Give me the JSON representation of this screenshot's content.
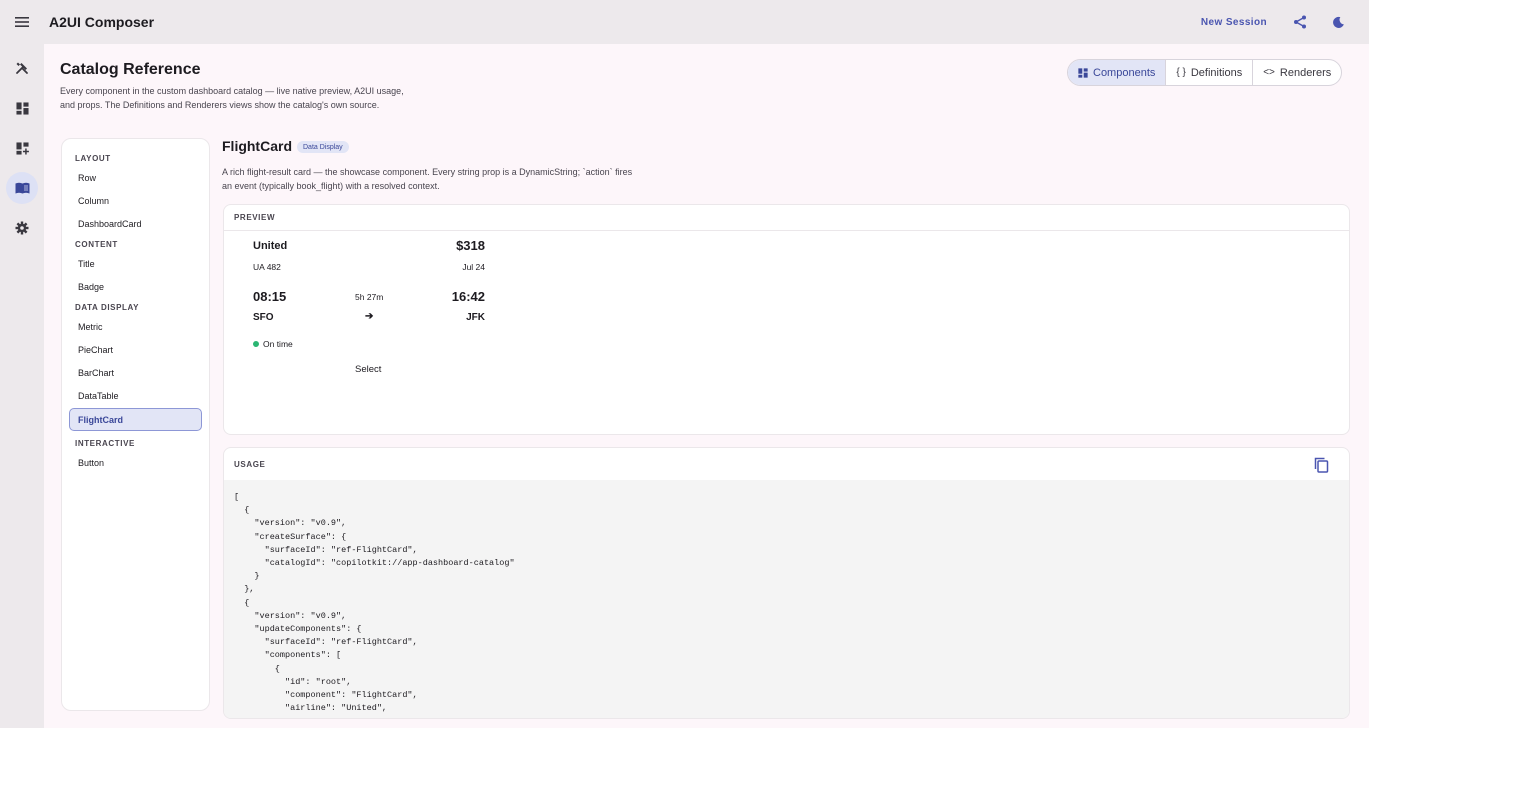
{
  "topbar": {
    "app_title": "A2UI Composer",
    "new_session_label": "New Session"
  },
  "colors": {
    "accent": "#4a55b0",
    "status_on_time": "#2bb673",
    "top_bar_bg": "#ede9ec",
    "page_bg": "#fdf6fa"
  },
  "rail": {
    "items": [
      {
        "icon": "tools-icon"
      },
      {
        "icon": "dashboard-icon"
      },
      {
        "icon": "dashboard-add-icon"
      },
      {
        "icon": "book-icon",
        "active": true
      },
      {
        "icon": "gear-icon"
      }
    ]
  },
  "header": {
    "title": "Catalog Reference",
    "description": "Every component in the custom dashboard catalog — live native preview, A2UI usage, and props. The Definitions and Renderers views show the catalog's own source."
  },
  "view_tabs": [
    {
      "label": "Components",
      "icon": "grid-icon",
      "active": true
    },
    {
      "label": "Definitions",
      "icon": "braces-icon",
      "active": false
    },
    {
      "label": "Renderers",
      "icon": "code-icon",
      "active": false
    }
  ],
  "catalog": {
    "groups": [
      {
        "label": "LAYOUT",
        "items": [
          "Row",
          "Column",
          "DashboardCard"
        ]
      },
      {
        "label": "CONTENT",
        "items": [
          "Title",
          "Badge"
        ]
      },
      {
        "label": "DATA DISPLAY",
        "items": [
          "Metric",
          "PieChart",
          "BarChart",
          "DataTable",
          "FlightCard"
        ]
      },
      {
        "label": "INTERACTIVE",
        "items": [
          "Button"
        ]
      }
    ],
    "selected": "FlightCard"
  },
  "detail": {
    "title": "FlightCard",
    "badge": "Data Display",
    "description": "A rich flight-result card — the showcase component. Every string prop is a DynamicString; `action` fires an event (typically book_flight) with a resolved context."
  },
  "preview": {
    "label": "PREVIEW",
    "card": {
      "airline": "United",
      "price": "$318",
      "flight_number": "UA 482",
      "date": "Jul 24",
      "depart_time": "08:15",
      "duration": "5h 27m",
      "arrive_time": "16:42",
      "origin": "SFO",
      "arrow": "➔",
      "destination": "JFK",
      "status": "On time",
      "select_label": "Select"
    }
  },
  "usage": {
    "label": "USAGE",
    "code": "[\n  {\n    \"version\": \"v0.9\",\n    \"createSurface\": {\n      \"surfaceId\": \"ref-FlightCard\",\n      \"catalogId\": \"copilotkit://app-dashboard-catalog\"\n    }\n  },\n  {\n    \"version\": \"v0.9\",\n    \"updateComponents\": {\n      \"surfaceId\": \"ref-FlightCard\",\n      \"components\": [\n        {\n          \"id\": \"root\",\n          \"component\": \"FlightCard\",\n          \"airline\": \"United\","
  }
}
